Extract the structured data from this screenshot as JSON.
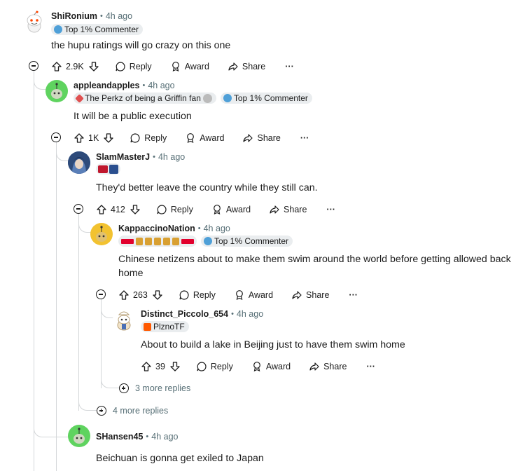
{
  "comments": [
    {
      "id": "c1",
      "author": "ShiRonium",
      "time": "4h ago",
      "flairs": [
        "Top 1% Commenter"
      ],
      "text": "the hupu ratings will go crazy on this one",
      "score": "2.9K",
      "avatar_color": "#ffffff"
    },
    {
      "id": "c2",
      "author": "appleandapples",
      "time": "4h ago",
      "flairs": [
        "The Perkz of being a Griffin fan",
        "Top 1% Commenter"
      ],
      "text": "It will be a public execution",
      "score": "1K",
      "avatar_color": "#5fd35f"
    },
    {
      "id": "c3",
      "author": "SlamMasterJ",
      "time": "4h ago",
      "flairs": [],
      "text": "They'd better leave the country while they still can.",
      "score": "412",
      "avatar_color": "#3a5f9a"
    },
    {
      "id": "c4",
      "author": "KappaccinoNation",
      "time": "4h ago",
      "flairs": [
        "Top 1% Commenter"
      ],
      "text": "Chinese netizens about to make them swim around the world before getting allowed back home",
      "score": "263",
      "avatar_color": "#f2c230"
    },
    {
      "id": "c5",
      "author": "Distinct_Piccolo_654",
      "time": "4h ago",
      "flairs": [
        "PlznoTF"
      ],
      "text": "About to build a lake in Beijing just to have them swim home",
      "score": "39",
      "avatar_color": "#ffffff"
    },
    {
      "id": "c6",
      "author": "SHansen45",
      "time": "4h ago",
      "flairs": [],
      "text": "Beichuan is gonna get exiled to Japan",
      "avatar_color": "#5fd35f"
    }
  ],
  "labels": {
    "reply": "Reply",
    "award": "Award",
    "share": "Share",
    "more_icon": "···"
  },
  "more_replies": {
    "inner": "3 more replies",
    "outer": "4 more replies"
  },
  "colors": {
    "meta": "#576f76",
    "line": "#d4d7d9",
    "flair_bg": "#eaedef",
    "t1_red": "#e2012d",
    "fnatic_orange": "#ff5900"
  }
}
